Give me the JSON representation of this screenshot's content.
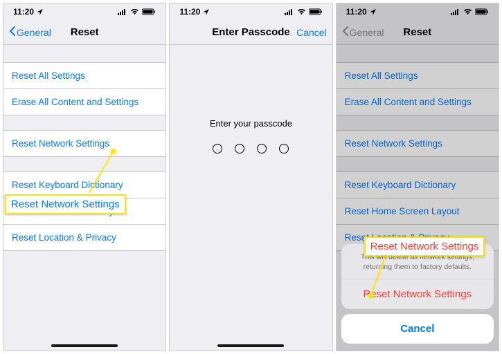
{
  "status": {
    "time": "11:20"
  },
  "screen1": {
    "nav": {
      "back": "General",
      "title": "Reset"
    },
    "items": [
      "Reset All Settings",
      "Erase All Content and Settings",
      "Reset Network Settings",
      "Reset Keyboard Dictionary",
      "Reset Home Screen Layout",
      "Reset Location & Privacy"
    ],
    "callout": "Reset Network Settings"
  },
  "screen2": {
    "nav": {
      "title": "Enter Passcode",
      "right": "Cancel"
    },
    "prompt": "Enter your passcode",
    "dot_count": 4
  },
  "screen3": {
    "nav": {
      "back": "General",
      "title": "Reset"
    },
    "items": [
      "Reset All Settings",
      "Erase All Content and Settings",
      "Reset Network Settings",
      "Reset Keyboard Dictionary",
      "Reset Home Screen Layout",
      "Reset Location & Privacy"
    ],
    "sheet": {
      "message": "This will delete all network settings, returning them to factory defaults.",
      "action": "Reset Network Settings",
      "cancel": "Cancel"
    },
    "callout": "Reset Network Settings"
  }
}
